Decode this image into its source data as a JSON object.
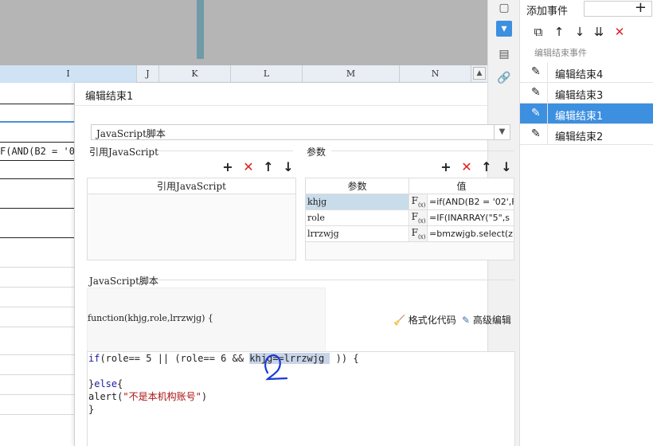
{
  "sheet": {
    "columns": [
      "I",
      "J",
      "K",
      "L",
      "M",
      "N"
    ],
    "selected_column": "I",
    "cell_formula": "F(AND(B2 = '0"
  },
  "right_panel": {
    "title": "添加事件",
    "subtitle": "编辑结束事件",
    "events": [
      "编辑结束4",
      "编辑结束3",
      "编辑结束1",
      "编辑结束2"
    ],
    "selected_event": "编辑结束1"
  },
  "dialog": {
    "title": "编辑结束1",
    "type_value": "JavaScript脚本",
    "ref_section": {
      "label": "引用JavaScript",
      "column_header": "引用JavaScript"
    },
    "param_section": {
      "label": "参数",
      "col_param": "参数",
      "col_value": "值",
      "fx_label": "F",
      "fx_sub": "(x)",
      "rows": [
        {
          "name": "khjg",
          "value": "=if(AND(B2 = '02',F"
        },
        {
          "name": "role",
          "value": "=IF(INARRAY(\"5\",s"
        },
        {
          "name": "lrrzwjg",
          "value": "=bmzwjgb.select(z"
        }
      ]
    },
    "script_section": {
      "label": "JavaScript脚本",
      "function_signature": "function(khjg,role,lrrzwjg) {",
      "format_button": "格式化代码",
      "advanced_button": "高级编辑",
      "code": {
        "line1_a": "if",
        "line1_b": "(role== 5 || (role== 6 && ",
        "line1_hl": "khjg==lrrzwjg ",
        "line1_c": " )) {",
        "line3_a": "}",
        "line3_b": "else",
        "line3_c": "{",
        "line4_a": "alert(",
        "line4_b": "\"不是本机构账号\"",
        "line4_c": ")",
        "line5": "}"
      }
    }
  }
}
